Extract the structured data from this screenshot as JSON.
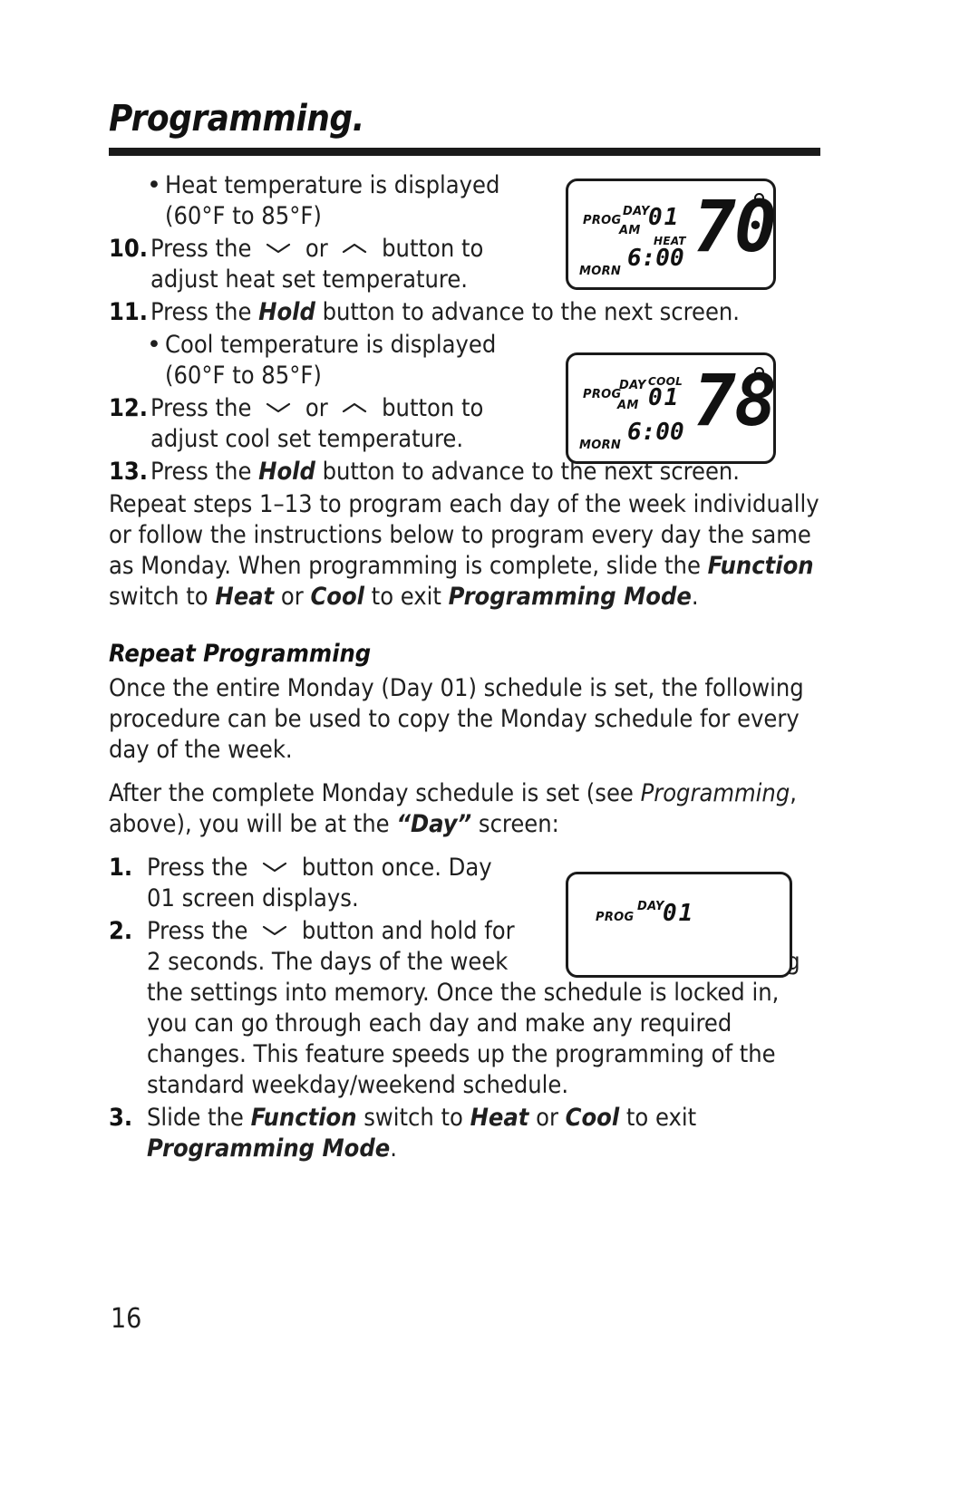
{
  "page": {
    "title": "Programming.",
    "number": "16"
  },
  "bullets": {
    "heat_line1": "Heat temperature is displayed",
    "heat_line2": "(60°F to 85°F)",
    "cool_line1": "Cool temperature is displayed",
    "cool_line2": "(60°F to 85°F)",
    "dot": "•"
  },
  "steps": {
    "s10": {
      "num": "10.",
      "pre": "Press the",
      "mid": "or",
      "post": "button to",
      "line2": "adjust heat set temperature."
    },
    "s11": {
      "num": "11.",
      "pre": "Press the ",
      "bold": "Hold",
      "post": " button to advance to the next screen."
    },
    "s12": {
      "num": "12.",
      "pre": "Press the",
      "mid": "or",
      "post": "button to",
      "line2": "adjust cool set temperature."
    },
    "s13": {
      "num": "13.",
      "pre": "Press the ",
      "bold": "Hold",
      "post": " button to advance to the next screen."
    }
  },
  "repeat_para": {
    "p1": "Repeat steps 1–13 to program each day of the week individually or follow the instructions below to program every day the same as Monday. When programming is complete, slide the ",
    "p1_b1": "Function",
    "p1_c": " switch to ",
    "p1_b2": "Heat",
    "p1_d": " or ",
    "p1_b3": "Cool",
    "p1_e": " to exit ",
    "p1_b4": "Programming Mode",
    "p1_f": "."
  },
  "section": {
    "heading": "Repeat Programming",
    "para1": "Once the entire Monday (Day 01) schedule is set, the following procedure can be used to copy the Monday schedule for every day of the week.",
    "para2_a": "After the complete Monday schedule is set (see ",
    "para2_i": "Programming",
    "para2_b": ", above), you will be at the ",
    "para2_q": "“Day”",
    "para2_c": " screen:"
  },
  "repeat_steps": {
    "r1": {
      "num": "1.",
      "pre": "Press the",
      "post": "button once. Day",
      "line2": "01 screen displays."
    },
    "r2": {
      "num": "2.",
      "pre": "Press the",
      "post": "button and hold for",
      "line2": "2 seconds. The days of the week",
      "line3": "stop flashing, locking the settings into memory. Once the schedule is locked in, you can go through each day and make any required changes. This feature speeds up the programming of the standard weekday/weekend schedule."
    },
    "r3": {
      "num": "3.",
      "a": "Slide the ",
      "b1": "Function",
      "b": " switch to ",
      "b2": "Heat",
      "c": " or ",
      "b3": "Cool",
      "d": " to exit",
      "b4": "Programming Mode",
      "e": "."
    }
  },
  "lcd_heat": {
    "prog": "PROG",
    "day": "DAY",
    "am": "AM",
    "day_value": "01",
    "mode": "HEAT",
    "time": "6:00",
    "morn": "MORN",
    "temperature": "70",
    "degree": "°"
  },
  "lcd_cool": {
    "prog": "PROG",
    "day": "DAY",
    "am": "AM",
    "day_value": "01",
    "mode": "COOL",
    "time": "6:00",
    "morn": "MORN",
    "temperature": "78",
    "degree": "°"
  },
  "lcd_day": {
    "prog": "PROG",
    "day": "DAY",
    "day_value": "01"
  },
  "icons": {
    "down_chevron": "chevron-down",
    "up_chevron": "chevron-up"
  },
  "colors": {
    "ink": "#1a1a1a",
    "body": "#1f1f1f",
    "paper": "#ffffff"
  }
}
